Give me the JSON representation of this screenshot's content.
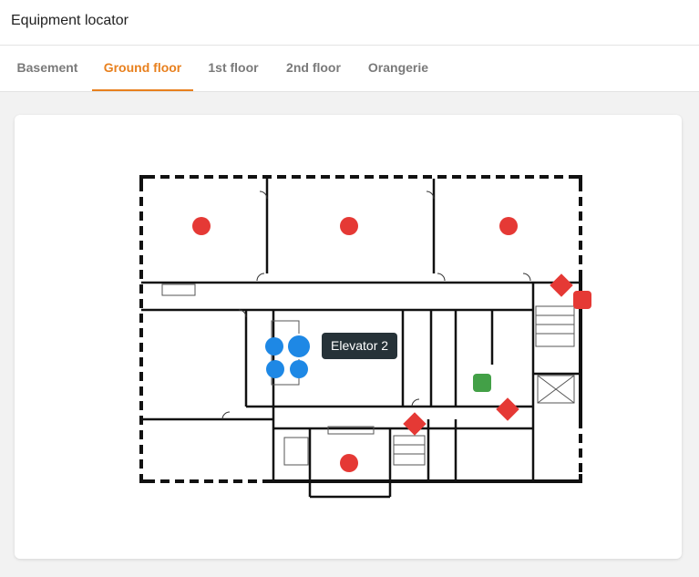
{
  "header": {
    "title": "Equipment locator"
  },
  "tabs": [
    {
      "label": "Basement",
      "active": false
    },
    {
      "label": "Ground floor",
      "active": true
    },
    {
      "label": "1st floor",
      "active": false
    },
    {
      "label": "2nd floor",
      "active": false
    },
    {
      "label": "Orangerie",
      "active": false
    }
  ],
  "colors": {
    "accent": "#e8801e",
    "marker_red": "#e53935",
    "marker_blue": "#1e88e5",
    "marker_green": "#43a047"
  },
  "map": {
    "tooltip": "Elevator 2",
    "markers": [
      {
        "name": "room-marker-1",
        "type": "circle",
        "color": "red"
      },
      {
        "name": "room-marker-2",
        "type": "circle",
        "color": "red"
      },
      {
        "name": "room-marker-3",
        "type": "circle",
        "color": "red"
      },
      {
        "name": "elevator-marker-1",
        "type": "circle",
        "color": "blue"
      },
      {
        "name": "elevator-marker-2",
        "type": "circle",
        "color": "blue"
      },
      {
        "name": "elevator-marker-3",
        "type": "circle",
        "color": "blue"
      },
      {
        "name": "elevator-marker-4",
        "type": "circle",
        "color": "blue"
      },
      {
        "name": "elevator-marker-5",
        "type": "circle",
        "color": "blue"
      },
      {
        "name": "equipment-marker-green",
        "type": "square",
        "color": "green"
      },
      {
        "name": "diamond-marker-1",
        "type": "diamond",
        "color": "red"
      },
      {
        "name": "square-marker-red",
        "type": "square",
        "color": "red"
      },
      {
        "name": "diamond-marker-2",
        "type": "diamond",
        "color": "red"
      },
      {
        "name": "diamond-marker-3",
        "type": "diamond",
        "color": "red"
      },
      {
        "name": "room-marker-4",
        "type": "circle",
        "color": "red"
      }
    ]
  }
}
